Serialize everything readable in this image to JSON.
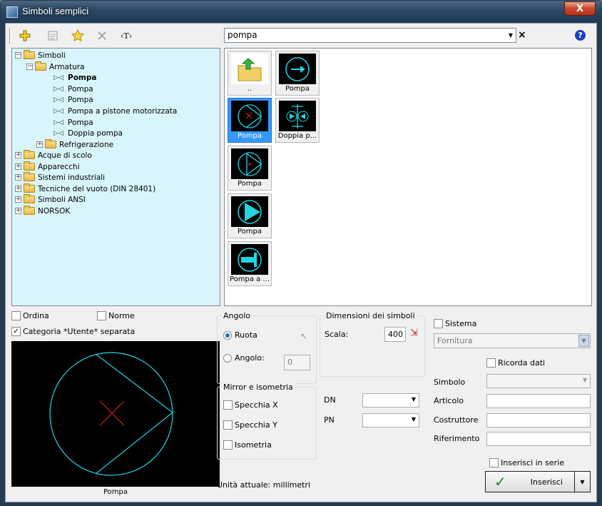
{
  "window": {
    "title": "Simboli semplici",
    "close_label": "X"
  },
  "toolbar": {
    "search_value": "pompa",
    "clear_label": "×",
    "help_label": "?",
    "text_btn_label": "‹T›"
  },
  "tree": [
    {
      "label": "Simboli",
      "expander": "−",
      "kind": "folder"
    },
    {
      "label": "Armatura",
      "expander": "−",
      "kind": "folder"
    },
    {
      "label": "Pompa",
      "kind": "leaf",
      "selected": true
    },
    {
      "label": "Pompa",
      "kind": "leaf"
    },
    {
      "label": "Pompa",
      "kind": "leaf"
    },
    {
      "label": "Pompa a pistone motorizzata",
      "kind": "leaf"
    },
    {
      "label": "Pompa",
      "kind": "leaf"
    },
    {
      "label": "Doppia pompa",
      "kind": "leaf"
    },
    {
      "label": "Refrigerazione",
      "expander": "+",
      "kind": "folder"
    },
    {
      "label": "Acque di scolo",
      "expander": "+",
      "kind": "folder"
    },
    {
      "label": "Apparecchi",
      "expander": "+",
      "kind": "folder"
    },
    {
      "label": "Sistemi industriali",
      "expander": "+",
      "kind": "folder"
    },
    {
      "label": "Tecniche del vuoto (DIN 28401)",
      "expander": "+",
      "kind": "folder"
    },
    {
      "label": "Simboli ANSI",
      "expander": "+",
      "kind": "folder"
    },
    {
      "label": "NORSOK",
      "expander": "+",
      "kind": "folder"
    }
  ],
  "tiles": [
    {
      "caption": "..",
      "icon": "folder-up-icon"
    },
    {
      "caption": "Pompa",
      "icon": "pump-arrow-icon"
    },
    {
      "caption": "Pompa",
      "icon": "pump-cross-icon",
      "selected": true
    },
    {
      "caption": "Doppia p...",
      "icon": "double-pump-icon"
    },
    {
      "caption": "Pompa",
      "icon": "pump-triangle-icon"
    },
    {
      "caption": "Pompa",
      "icon": "pump-filled-icon"
    },
    {
      "caption": "Pompa a ...",
      "icon": "piston-pump-icon"
    }
  ],
  "options": {
    "ordina": "Ordina",
    "norme": "Norme",
    "categoria": "Categoria *Utente* separata",
    "categoria_checked": true
  },
  "preview_caption": "Pompa",
  "angle": {
    "group_label": "Angolo",
    "rotate_label": "Ruota",
    "angle_label": "Angolo:",
    "angle_value": "0",
    "selected": "rotate"
  },
  "dimensions": {
    "group_label": "Dimensioni dei simboli",
    "scale_label": "Scala:",
    "scale_value": "400"
  },
  "mirror": {
    "group_label": "Mirror e isometria",
    "mirror_x": "Specchia X",
    "mirror_y": "Specchia Y",
    "isometric": "Isometria"
  },
  "pipe": {
    "dn_label": "DN",
    "pn_label": "PN"
  },
  "units_text": "Unità attuale: millimetri",
  "system": {
    "sistema_label": "Sistema",
    "fornitura_value": "Fornitura",
    "remember_label": "Ricorda dati",
    "simbolo_label": "Simbolo",
    "articolo_label": "Articolo",
    "costruttore_label": "Costruttore",
    "riferimento_label": "Riferimento",
    "serie_label": "Inserisci in serie",
    "insert_label": "Inserisci"
  },
  "colors": {
    "tree_bg": "#d8f5fb",
    "symbol_cyan": "#22d3e0",
    "symbol_red": "#d0201a",
    "selection": "#3399ff"
  }
}
